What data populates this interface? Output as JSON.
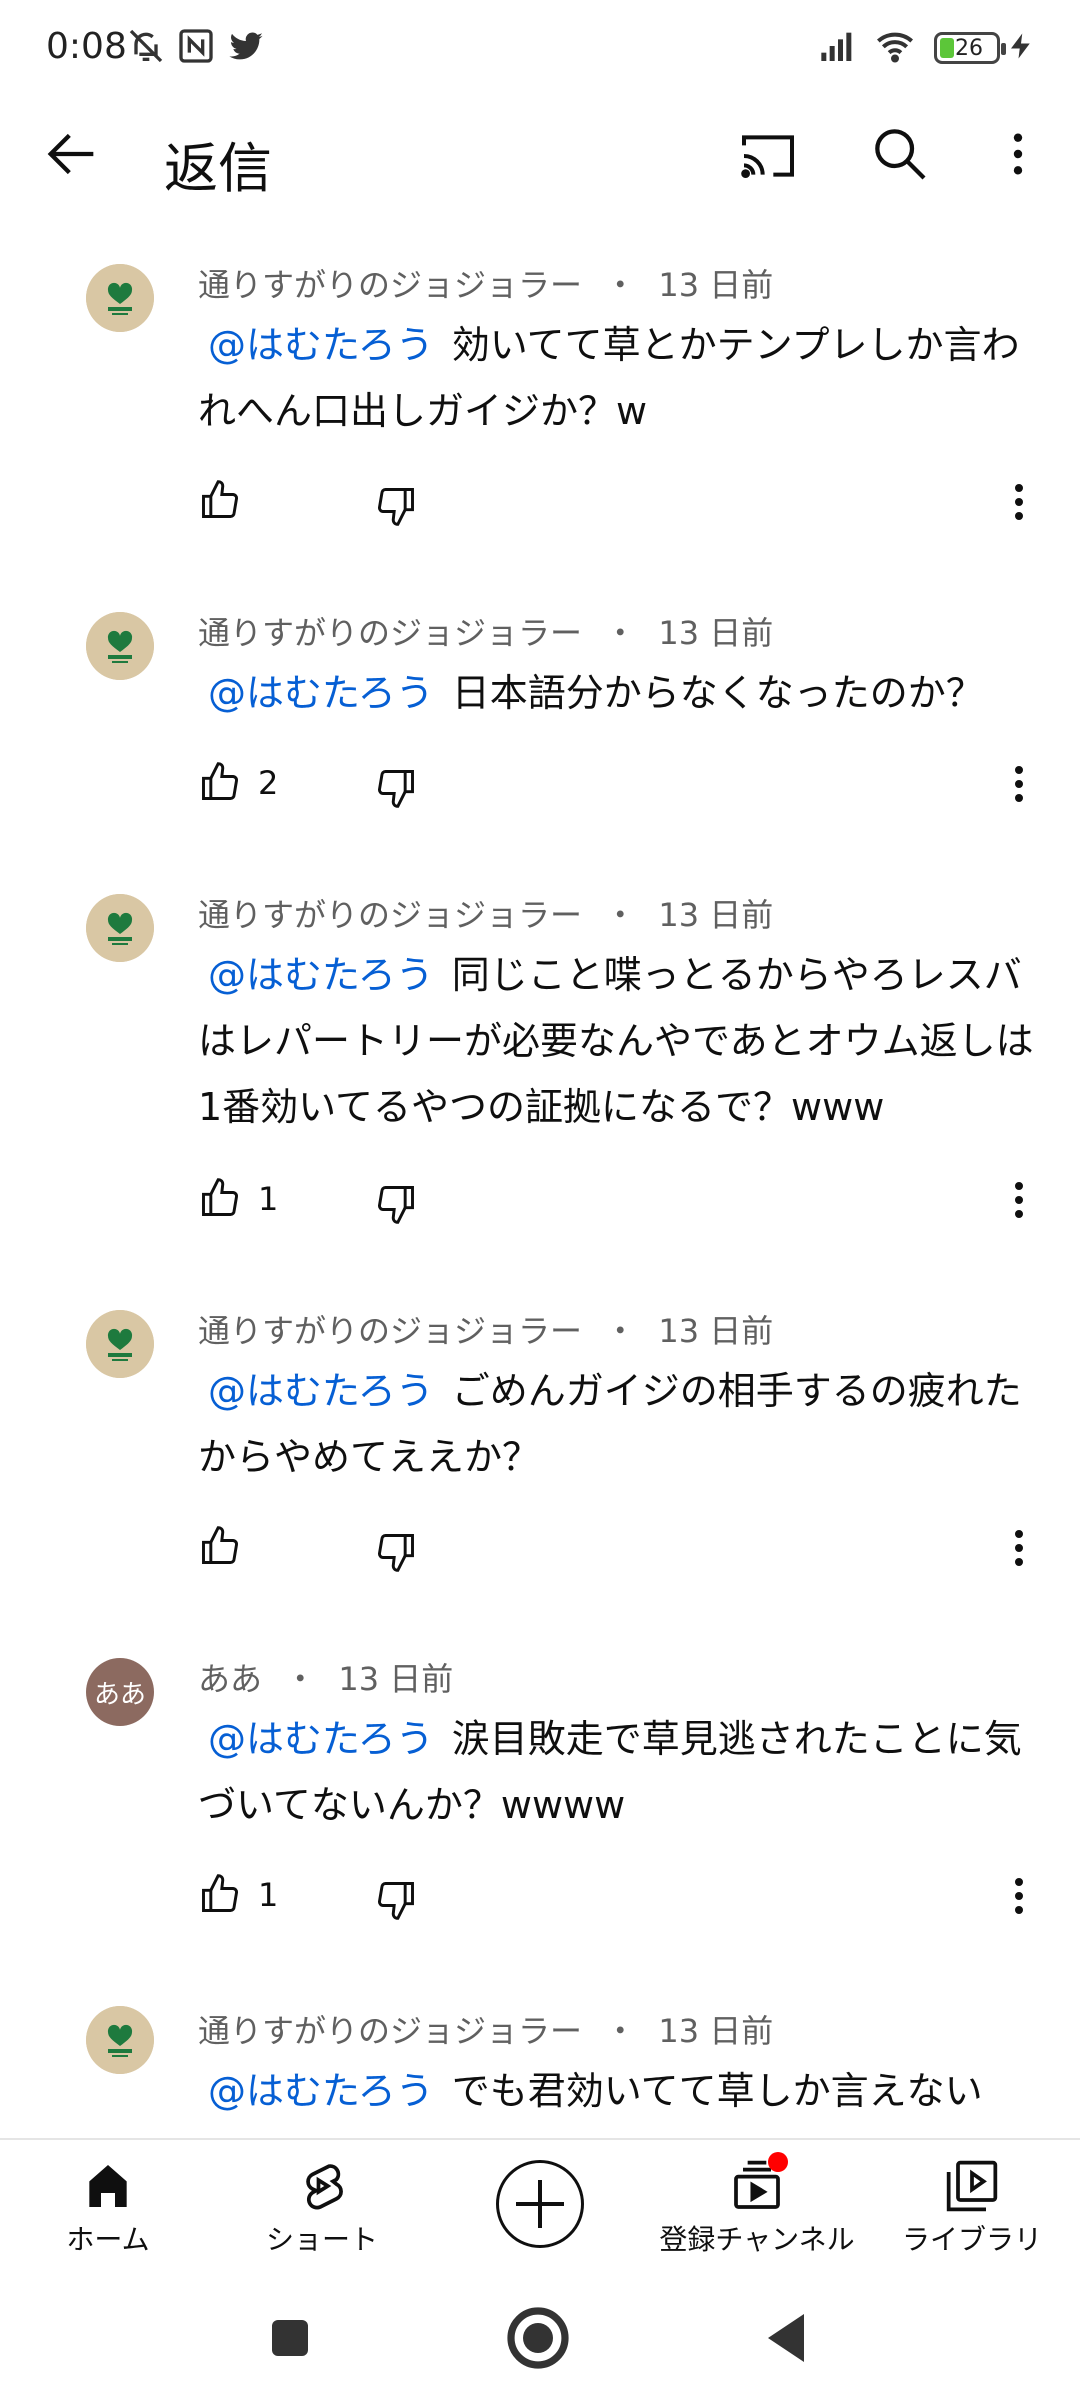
{
  "status_bar": {
    "time": "0:08",
    "battery": "26",
    "icons": [
      "muted-bell-icon",
      "nfc-icon",
      "twitter-icon",
      "signal-icon",
      "wifi-icon",
      "battery-icon",
      "charging-icon"
    ]
  },
  "app_bar": {
    "title": "返信",
    "icons": [
      "back-arrow-icon",
      "cast-icon",
      "search-icon",
      "more-vert-icon"
    ]
  },
  "comments": [
    {
      "author": "通りすがりのジョジョラー",
      "age": "13 日前",
      "mention": "@はむたろう",
      "text": "効いてて草とかテンプレしか言われへん口出しガイジか？w",
      "likes": ""
    },
    {
      "author": "通りすがりのジョジョラー",
      "age": "13 日前",
      "mention": "@はむたろう",
      "text": "日本語分からなくなったのか？",
      "likes": "2"
    },
    {
      "author": "通りすがりのジョジョラー",
      "age": "13 日前",
      "mention": "@はむたろう",
      "text": "同じこと喋っとるからやろレスバはレパートリーが必要なんやであとオウム返しは1番効いてるやつの証拠になるで？www",
      "likes": "1"
    },
    {
      "author": "通りすがりのジョジョラー",
      "age": "13 日前",
      "mention": "@はむたろう",
      "text": "ごめんガイジの相手するの疲れたからやめてええか？",
      "likes": ""
    },
    {
      "author": "ああ",
      "age": "13 日前",
      "mention": "@はむたろう",
      "text": "涙目敗走で草見逃されたことに気づいてないんか？wwww",
      "likes": "1",
      "avatar_text": "ああ"
    },
    {
      "author": "通りすがりのジョジョラー",
      "age": "13 日前",
      "mention": "@はむたろう",
      "text": "でも君効いてて草しか言えない",
      "likes": ""
    }
  ],
  "separator": "・",
  "bottom_nav": {
    "home": "ホーム",
    "shorts": "ショート",
    "subscriptions": "登録チャンネル",
    "library": "ライブラリ"
  },
  "colors": {
    "mention": "#065fd4",
    "meta": "#606060",
    "notification_dot": "#ff0000",
    "battery_fill": "#5cc639"
  }
}
